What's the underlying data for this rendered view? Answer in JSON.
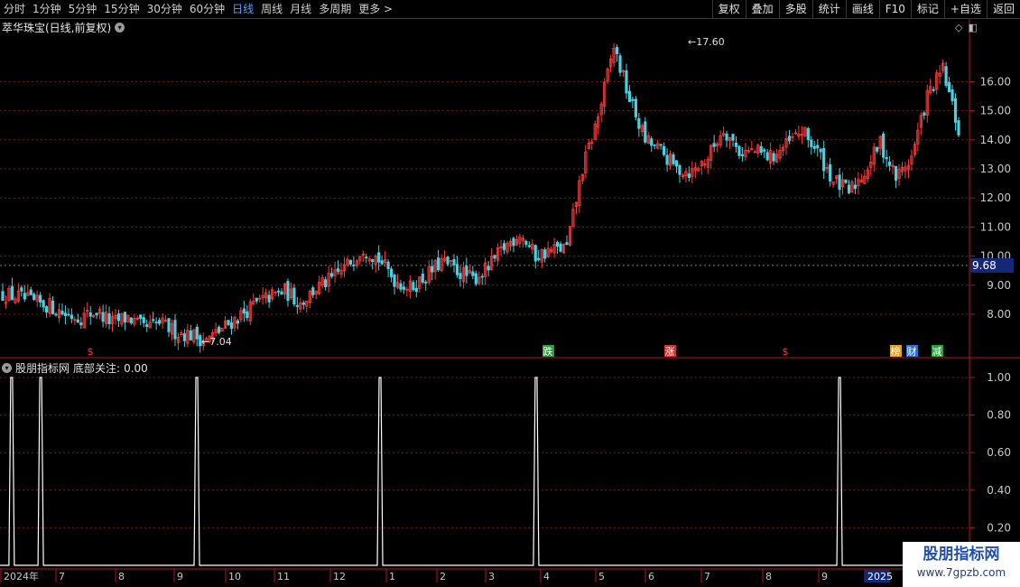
{
  "toolbar": {
    "periods": [
      "分时",
      "1分钟",
      "5分钟",
      "15分钟",
      "30分钟",
      "60分钟",
      "日线",
      "周线",
      "月线",
      "多周期",
      "更多 >"
    ],
    "active": "日线",
    "buttons": [
      "复权",
      "叠加",
      "多股",
      "统计",
      "画线",
      "F10",
      "标记",
      "+自选",
      "返回"
    ]
  },
  "main_title": "萃华珠宝(日线,前复权)",
  "indicator_title": "股朋指标网",
  "indicator_series": "底部关注:",
  "indicator_value": "0.00",
  "corner_icons": [
    "diamond-icon",
    "panel-toggle-icon"
  ],
  "watermark": {
    "main": "股朋指标网",
    "url": "www.7gpzb.com"
  },
  "colors": {
    "up": "#ff3b3b",
    "down": "#48d1e0",
    "grid": "#7a1a1a",
    "axis": "#b01818",
    "price_tag_bg": "#14287a"
  },
  "chart_data": [
    {
      "type": "candlestick",
      "title": "萃华珠宝(日线,前复权)",
      "y_ticks": [
        8.0,
        9.0,
        10.0,
        11.0,
        12.0,
        13.0,
        14.0,
        15.0,
        16.0
      ],
      "ylim": [
        7.0,
        18.0
      ],
      "current_price": "9.68",
      "annotations": [
        {
          "label": "17.60",
          "value": 17.6
        },
        {
          "label": "7.04",
          "value": 7.04
        }
      ],
      "event_markers": [
        {
          "text": "$",
          "color": "#ff3b3b"
        },
        {
          "text": "跌",
          "color": "#2a9d3a"
        },
        {
          "text": "涨",
          "color": "#d23030"
        },
        {
          "text": "$",
          "color": "#ff3b3b"
        },
        {
          "text": "榜",
          "color": "#e0a020"
        },
        {
          "text": "财",
          "color": "#2f6fd0"
        },
        {
          "text": "减",
          "color": "#2a9d3a"
        }
      ],
      "close_path": [
        8.7,
        8.6,
        8.4,
        8.3,
        8.0,
        7.9,
        8.1,
        7.7,
        7.9,
        7.5,
        7.7,
        7.4,
        7.3,
        7.1,
        7.5,
        7.9,
        8.3,
        8.6,
        8.8,
        8.4,
        8.9,
        9.2,
        9.7,
        10.3,
        9.9,
        9.2,
        8.9,
        9.3,
        9.8,
        9.5,
        9.2,
        9.6,
        10.3,
        10.8,
        10.0,
        10.2,
        10.3,
        13.0,
        14.8,
        17.2,
        15.4,
        14.0,
        13.6,
        13.0,
        12.9,
        13.4,
        14.4,
        13.6,
        13.6,
        13.4,
        13.8,
        14.3,
        13.6,
        12.6,
        12.2,
        12.9,
        13.9,
        12.7,
        13.4,
        15.5,
        16.4,
        14.3
      ]
    },
    {
      "type": "line",
      "series": [
        {
          "name": "底部关注",
          "values": [
            1,
            1,
            1,
            1,
            1,
            1,
            0
          ]
        }
      ],
      "spike_positions": [
        0.012,
        0.042,
        0.203,
        0.392,
        0.553,
        0.866
      ],
      "y_ticks": [
        0.2,
        0.4,
        0.6,
        0.8,
        1.0
      ],
      "ylim": [
        0,
        1.05
      ]
    }
  ],
  "x_axis": {
    "labels": [
      "2024年",
      "7",
      "8",
      "9",
      "10",
      "11",
      "12",
      "1",
      "2",
      "3",
      "4",
      "5",
      "6",
      "7",
      "8",
      "9",
      "2025"
    ]
  }
}
